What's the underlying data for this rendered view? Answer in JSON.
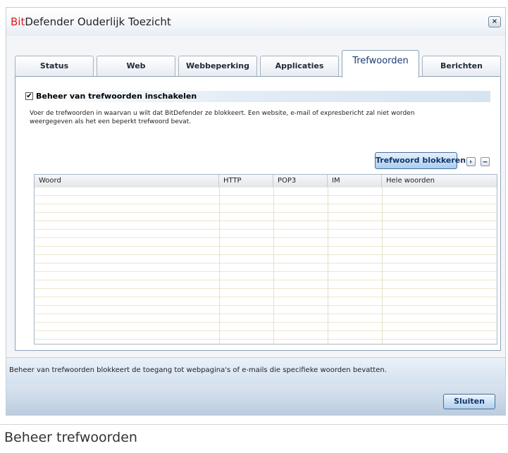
{
  "window": {
    "title_brand": "Bit",
    "title_rest": "Defender Ouderlijk Toezicht",
    "close_glyph": "×"
  },
  "tabs": [
    {
      "label": "Status",
      "active": false
    },
    {
      "label": "Web",
      "active": false
    },
    {
      "label": "Webbeperking",
      "active": false
    },
    {
      "label": "Applicaties",
      "active": false
    },
    {
      "label": "Trefwoorden",
      "active": true
    },
    {
      "label": "Berichten",
      "active": false
    }
  ],
  "section": {
    "checked": true,
    "check_glyph": "✔",
    "label": "Beheer van trefwoorden inschakelen",
    "description": "Voer de trefwoorden in waarvan u wilt dat BitDefender ze blokkeert. Een website, e-mail of expresbericht zal niet worden weergegeven als het een beperkt trefwoord bevat."
  },
  "toolbar": {
    "block_button": "Trefwoord blokkeren",
    "next_icon": "play-icon",
    "remove_icon": "minus-icon"
  },
  "table": {
    "columns": [
      "Woord",
      "HTTP",
      "POP3",
      "IM",
      "Hele woorden"
    ],
    "rows": []
  },
  "status": {
    "text": "Beheer van trefwoorden blokkeert de toegang tot webpagina's of e-mails die specifieke woorden bevatten."
  },
  "footer": {
    "close_button": "Sluiten"
  },
  "caption": "Beheer trefwoorden",
  "colors": {
    "brand_red": "#e01c1c",
    "accent_blue": "#13366b"
  }
}
